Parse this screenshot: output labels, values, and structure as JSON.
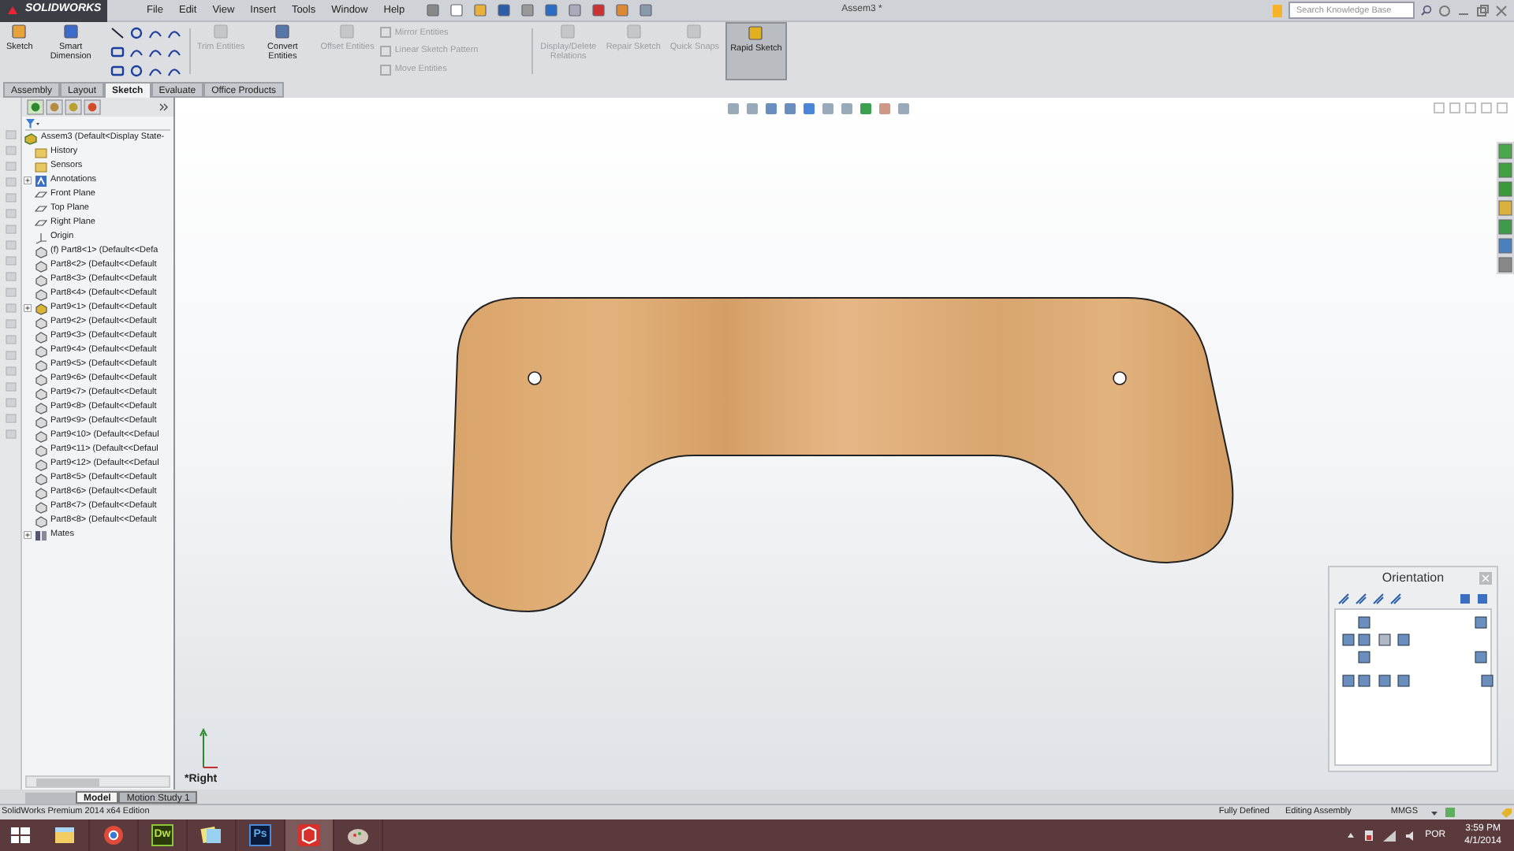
{
  "app": {
    "logo": "SOLIDWORKS",
    "menu": [
      "File",
      "Edit",
      "View",
      "Insert",
      "Tools",
      "Window",
      "Help"
    ],
    "title": "Assem3 *",
    "search": {
      "placeholder": "Search Knowledge Base"
    }
  },
  "ribbon": {
    "large": [
      {
        "label": "Sketch",
        "disabled": false
      },
      {
        "label": "Smart Dimension",
        "disabled": false
      }
    ],
    "mid": [
      {
        "label": "Trim Entities",
        "disabled": true
      },
      {
        "label": "Convert Entities",
        "disabled": false
      },
      {
        "label": "Offset Entities",
        "disabled": true
      }
    ],
    "small": [
      {
        "label": "Mirror Entities",
        "disabled": true
      },
      {
        "label": "Linear Sketch Pattern",
        "disabled": true
      },
      {
        "label": "Move Entities",
        "disabled": true
      }
    ],
    "right": [
      {
        "label": "Display/Delete Relations",
        "disabled": true,
        "selected": false
      },
      {
        "label": "Repair Sketch",
        "disabled": true,
        "selected": false
      },
      {
        "label": "Quick Snaps",
        "disabled": true,
        "selected": false
      },
      {
        "label": "Rapid Sketch",
        "disabled": false,
        "selected": true
      }
    ]
  },
  "tabs": [
    {
      "label": "Assembly",
      "selected": false
    },
    {
      "label": "Layout",
      "selected": false
    },
    {
      "label": "Sketch",
      "selected": true
    },
    {
      "label": "Evaluate",
      "selected": false
    },
    {
      "label": "Office Products",
      "selected": false
    }
  ],
  "tree": {
    "root": "Assem3  (Default<Display State-",
    "children": [
      {
        "label": "History",
        "kind": "folder",
        "expandable": false
      },
      {
        "label": "Sensors",
        "kind": "folder",
        "expandable": false
      },
      {
        "label": "Annotations",
        "kind": "annotation",
        "expandable": true
      },
      {
        "label": "Front Plane",
        "kind": "plane",
        "expandable": false
      },
      {
        "label": "Top Plane",
        "kind": "plane",
        "expandable": false
      },
      {
        "label": "Right Plane",
        "kind": "plane",
        "expandable": false
      },
      {
        "label": "Origin",
        "kind": "origin",
        "expandable": false
      },
      {
        "label": "(f) Part8<1> (Default<<Defa",
        "kind": "part",
        "expandable": false
      },
      {
        "label": "Part8<2> (Default<<Default",
        "kind": "part",
        "expandable": false
      },
      {
        "label": "Part8<3> (Default<<Default",
        "kind": "part",
        "expandable": false
      },
      {
        "label": "Part8<4> (Default<<Default",
        "kind": "part",
        "expandable": false
      },
      {
        "label": "Part9<1> (Default<<Default",
        "kind": "subassembly",
        "expandable": true
      },
      {
        "label": "Part9<2> (Default<<Default",
        "kind": "part",
        "expandable": false
      },
      {
        "label": "Part9<3> (Default<<Default",
        "kind": "part",
        "expandable": false
      },
      {
        "label": "Part9<4> (Default<<Default",
        "kind": "part",
        "expandable": false
      },
      {
        "label": "Part9<5> (Default<<Default",
        "kind": "part",
        "expandable": false
      },
      {
        "label": "Part9<6> (Default<<Default",
        "kind": "part",
        "expandable": false
      },
      {
        "label": "Part9<7> (Default<<Default",
        "kind": "part",
        "expandable": false
      },
      {
        "label": "Part9<8> (Default<<Default",
        "kind": "part",
        "expandable": false
      },
      {
        "label": "Part9<9> (Default<<Default",
        "kind": "part",
        "expandable": false
      },
      {
        "label": "Part9<10> (Default<<Defaul",
        "kind": "part",
        "expandable": false
      },
      {
        "label": "Part9<11> (Default<<Defaul",
        "kind": "part",
        "expandable": false
      },
      {
        "label": "Part9<12> (Default<<Defaul",
        "kind": "part",
        "expandable": false
      },
      {
        "label": "Part8<5> (Default<<Default",
        "kind": "part",
        "expandable": false
      },
      {
        "label": "Part8<6> (Default<<Default",
        "kind": "part",
        "expandable": false
      },
      {
        "label": "Part8<7> (Default<<Default",
        "kind": "part",
        "expandable": false
      },
      {
        "label": "Part8<8> (Default<<Default",
        "kind": "part",
        "expandable": false
      },
      {
        "label": "Mates",
        "kind": "mates",
        "expandable": true
      }
    ]
  },
  "viewport": {
    "view_label": "*Right",
    "orientation": {
      "title": "Orientation"
    }
  },
  "bottom_tabs": [
    {
      "label": "Model",
      "selected": true
    },
    {
      "label": "Motion Study 1",
      "selected": false
    }
  ],
  "status_bar": {
    "edition": "SolidWorks Premium 2014 x64 Edition",
    "state": "Fully Defined",
    "mode": "Editing Assembly",
    "units": "MMGS"
  },
  "taskbar": {
    "apps": [
      {
        "kind": "explorer",
        "active": false
      },
      {
        "kind": "chrome",
        "active": false
      },
      {
        "kind": "dreamweaver",
        "label": "Dw",
        "active": false
      },
      {
        "kind": "notes",
        "active": false
      },
      {
        "kind": "photoshop",
        "label": "Ps",
        "active": false
      },
      {
        "kind": "solidworks",
        "active": true
      },
      {
        "kind": "paint",
        "active": false
      }
    ],
    "language": "POR",
    "time": "3:59 PM",
    "date": "4/1/2014"
  }
}
